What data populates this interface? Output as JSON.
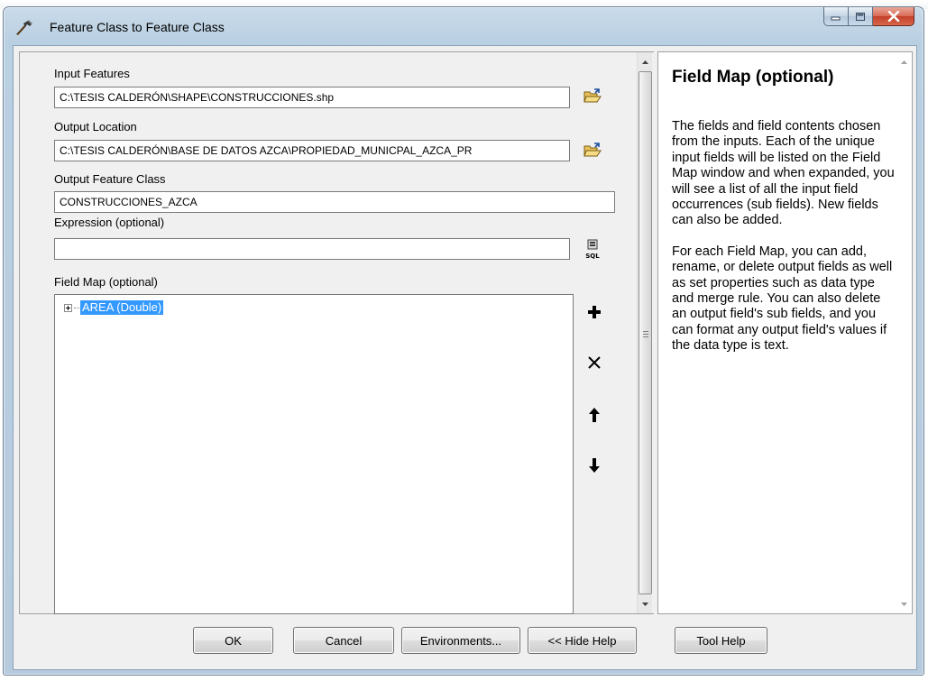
{
  "window": {
    "title": "Feature Class to Feature Class"
  },
  "form": {
    "input_features": {
      "label": "Input Features",
      "value": "C:\\TESIS CALDERÓN\\SHAPE\\CONSTRUCCIONES.shp",
      "browse_icon": "open-folder-icon"
    },
    "output_location": {
      "label": "Output Location",
      "value": "C:\\TESIS CALDERÓN\\BASE DE DATOS AZCA\\PROPIEDAD_MUNICPAL_AZCA_PR",
      "browse_icon": "open-folder-icon"
    },
    "output_feature_class": {
      "label": "Output Feature Class",
      "value": "CONSTRUCCIONES_AZCA"
    },
    "expression": {
      "label": "Expression (optional)",
      "value": "",
      "sql_icon": "sql-icon"
    },
    "field_map": {
      "label": "Field Map (optional)",
      "items": [
        {
          "label": "AREA (Double)",
          "expanded": false,
          "selected": true
        }
      ],
      "tools": [
        "add-icon",
        "delete-icon",
        "move-up-icon",
        "move-down-icon"
      ]
    }
  },
  "help": {
    "title": "Field Map (optional)",
    "paragraphs": [
      "The fields and field contents chosen from the inputs. Each of the unique input fields will be listed on the Field Map window and when expanded, you will see a list of all the input field occurrences (sub fields). New fields can also be added.",
      "For each Field Map, you can add, rename, or delete output fields as well as set properties such as data type and merge rule. You can also delete an output field's sub fields, and you can format any output field's values if the data type is text."
    ]
  },
  "buttons": {
    "ok": "OK",
    "cancel": "Cancel",
    "environments": "Environments...",
    "hide_help": "<< Hide Help",
    "tool_help": "Tool Help"
  },
  "colors": {
    "selection": "#3399ff",
    "close_button": "#c3402a",
    "frame": "#b9cfe2"
  }
}
